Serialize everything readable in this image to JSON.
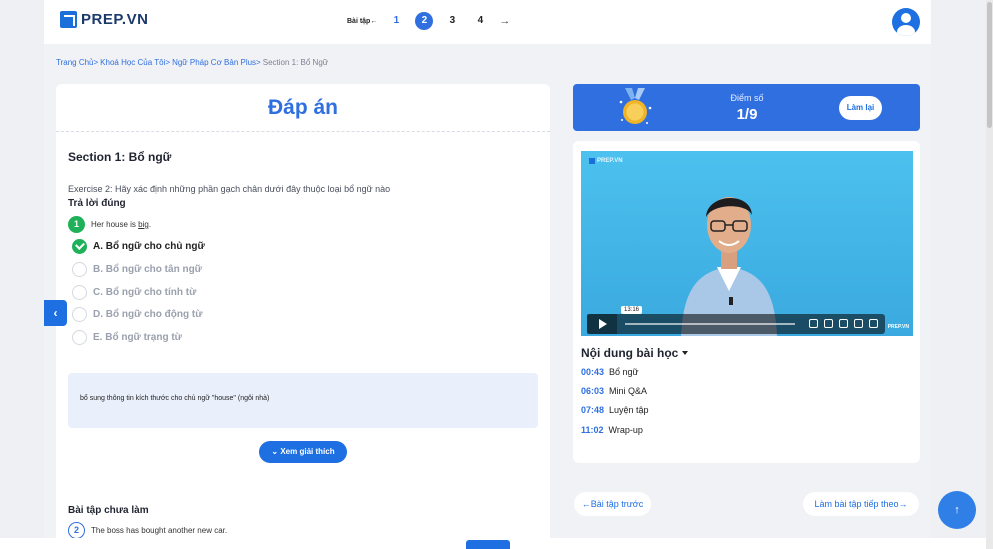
{
  "header": {
    "logo_text": "PREP.VN",
    "pager_label": "Bài tập←",
    "pages": [
      "1",
      "2",
      "3",
      "4"
    ],
    "active_page": "2",
    "next_arrow": "→"
  },
  "breadcrumb": [
    "Trang Chủ>",
    "Khoá Học Của Tôi>",
    "Ngữ Pháp Cơ Bản Plus>",
    "Section 1: Bổ Ngữ"
  ],
  "left": {
    "title": "Đáp án",
    "section_title": "Section 1: Bổ ngữ",
    "exercise_text": "Exercise 2: Hãy xác định những phần gạch chân dưới đây thuộc loại bổ ngữ nào",
    "correct_label": "Trả lời đúng",
    "question1": {
      "number": "1",
      "text_before": "Her house is ",
      "underlined": "big",
      "text_after": "."
    },
    "options": [
      {
        "label": "A. Bổ ngữ cho chủ ngữ",
        "correct": true
      },
      {
        "label": "B. Bổ ngữ cho tân ngữ",
        "correct": false
      },
      {
        "label": "C. Bổ ngữ cho tính từ",
        "correct": false
      },
      {
        "label": "D. Bổ ngữ cho động từ",
        "correct": false
      },
      {
        "label": "E. Bổ ngữ trạng từ",
        "correct": false
      }
    ],
    "explanation": "bổ sung thông tin kích thước cho chủ ngữ \"house\" (ngôi nhà)",
    "explain_button": "Xem giải thích",
    "unfinished_title": "Bài tập chưa làm",
    "question2": {
      "number": "2",
      "text": "The boss has bought another new car."
    }
  },
  "score": {
    "label": "Điểm số",
    "value": "1/9",
    "retry_button": "Làm lại"
  },
  "video": {
    "logo": "PREP.VN",
    "time_tooltip": "13:16",
    "watermark": "PREP.VN"
  },
  "lesson": {
    "title": "Nội dung bài học",
    "items": [
      {
        "time": "00:43",
        "name": "Bổ ngữ"
      },
      {
        "time": "06:03",
        "name": "Mini Q&A"
      },
      {
        "time": "07:48",
        "name": "Luyện tập"
      },
      {
        "time": "11:02",
        "name": "Wrap-up"
      }
    ]
  },
  "nav": {
    "prev": "←Bài tập trước",
    "next": "Làm bài tập tiếp theo→",
    "top_arrow": "↑",
    "collapse_arrow": "‹"
  },
  "colors": {
    "accent": "#2f6fe0",
    "success": "#1fb05a"
  }
}
